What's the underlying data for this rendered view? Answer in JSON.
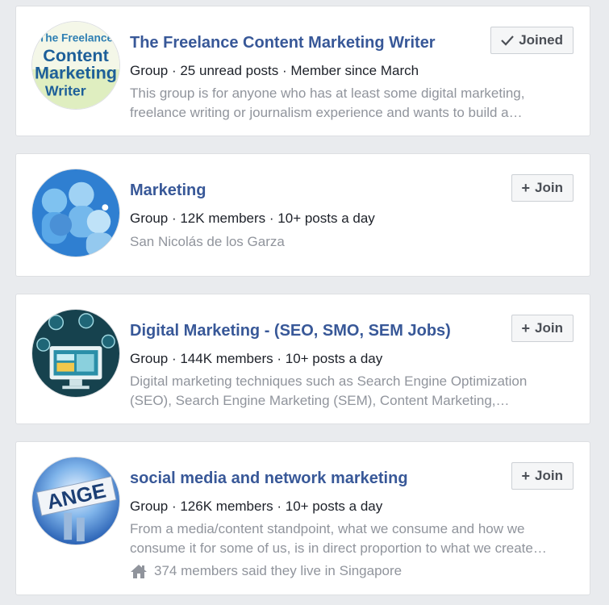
{
  "groups": [
    {
      "name": "The Freelance Content Marketing Writer",
      "meta": "Group · 25 unread posts · Member since March",
      "description": "This group is for anyone who has at least some digital marketing, freelance writing or journalism experience and wants to build a…",
      "button_label": "Joined",
      "button_icon": "checkmark-icon",
      "avatar_text": [
        "The Freelance",
        "Content",
        "Marketing",
        "Writer"
      ]
    },
    {
      "name": "Marketing",
      "meta": "Group · 12K members · 10+ posts a day",
      "location": "San Nicolás de los Garza",
      "button_label": "Join",
      "button_icon": "plus-icon"
    },
    {
      "name": "Digital Marketing - (SEO, SMO, SEM Jobs)",
      "meta": "Group · 144K members · 10+ posts a day",
      "description": "Digital marketing techniques such as Search Engine Optimization (SEO), Search Engine Marketing (SEM), Content Marketing,…",
      "button_label": "Join",
      "button_icon": "plus-icon"
    },
    {
      "name": "social media and network marketing",
      "meta": "Group · 126K members · 10+ posts a day",
      "description": "From a media/content standpoint, what we consume and how we consume it for some of us, is in direct proportion to what we create…",
      "extra": "374 members said they live in Singapore",
      "extra_icon": "home-icon",
      "button_label": "Join",
      "button_icon": "plus-icon",
      "avatar_text": "ANGE"
    }
  ],
  "colors": {
    "title": "#385898",
    "background": "#e9ebee",
    "muted": "#90949c"
  }
}
